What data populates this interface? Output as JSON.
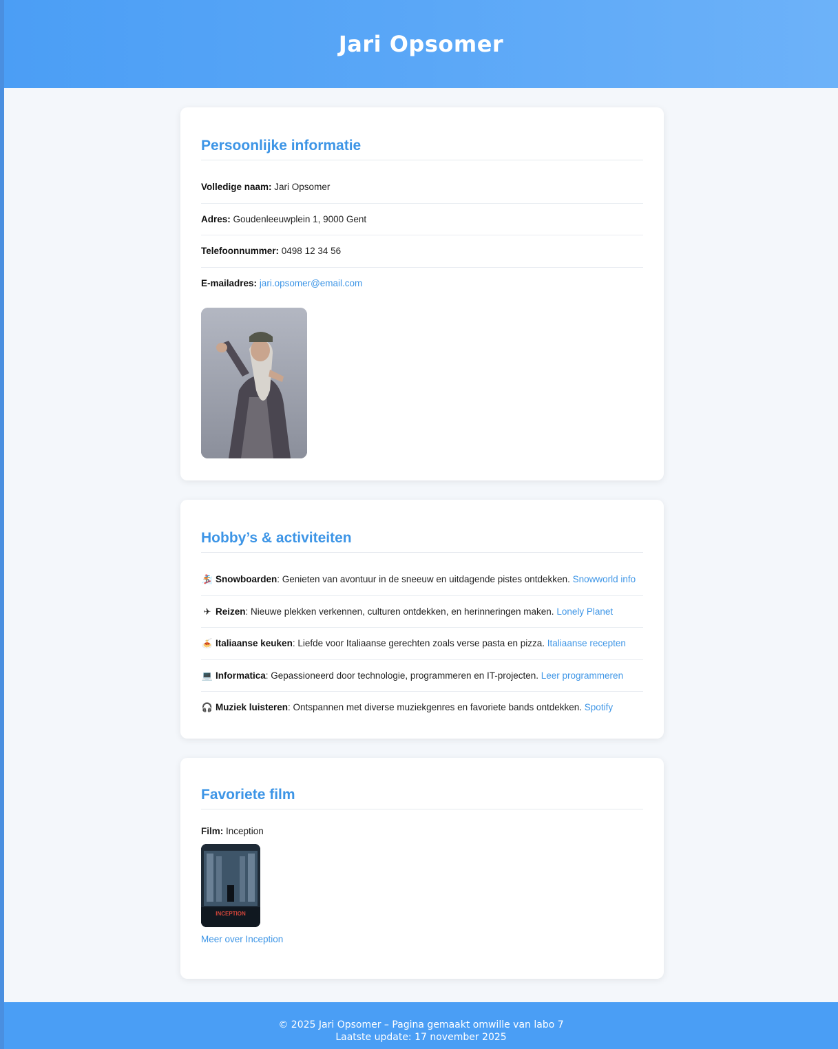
{
  "header": {
    "title": "Jari Opsomer"
  },
  "personal": {
    "heading": "Persoonlijke informatie",
    "rows": [
      {
        "label": "Volledige naam:",
        "value": "Jari Opsomer"
      },
      {
        "label": "Adres:",
        "value": "Goudenleeuwplein 1, 9000 Gent"
      },
      {
        "label": "Telefoonnummer:",
        "value": "0498 12 34 56"
      },
      {
        "label": "E-mailadres:",
        "value": "jari.opsomer@email.com"
      }
    ]
  },
  "hobbies": {
    "heading": "Hobby’s & activiteiten",
    "items": [
      {
        "icon": "snowboard-icon",
        "title": "Snowboarden",
        "text": ": Genieten van avontuur in de sneeuw en uitdagende pistes ontdekken. ",
        "link": "Snowworld info"
      },
      {
        "icon": "airplane-icon",
        "title": "Reizen",
        "text": ": Nieuwe plekken verkennen, culturen ontdekken, en herinneringen maken. ",
        "link": "Lonely Planet"
      },
      {
        "icon": "spaghetti-icon",
        "title": "Italiaanse keuken",
        "text": ": Liefde voor Italiaanse gerechten zoals verse pasta en pizza. ",
        "link": "Italiaanse recepten"
      },
      {
        "icon": "laptop-icon",
        "title": "Informatica",
        "text": ": Gepassioneerd door technologie, programmeren en IT-projecten. ",
        "link": "Leer programmeren"
      },
      {
        "icon": "headphones-icon",
        "title": "Muziek luisteren",
        "text": ": Ontspannen met diverse muziekgenres en favoriete bands ontdekken. ",
        "link": "Spotify"
      }
    ]
  },
  "movie": {
    "heading": "Favoriete film",
    "label": "Film:",
    "value": "Inception",
    "poster_text": "INCEPTION",
    "link": "Meer over Inception"
  },
  "footer": {
    "line1": "© 2025 Jari Opsomer – Pagina gemaakt omwille van labo 7",
    "line2": "Laatste update: 17 november 2025"
  },
  "colors": {
    "accent": "#3d95e6",
    "header": "#4b9ef5",
    "footer": "#4a9ef5"
  }
}
